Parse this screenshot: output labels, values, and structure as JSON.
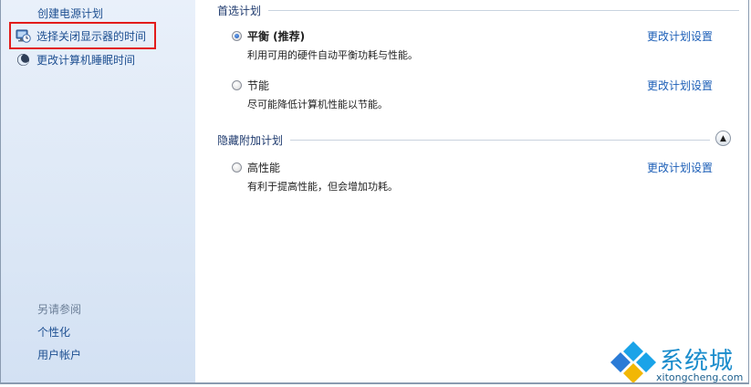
{
  "sidebar": {
    "items": [
      {
        "label": "创建电源计划",
        "icon": "none"
      },
      {
        "label": "选择关闭显示器的时间",
        "icon": "monitor-clock-icon"
      },
      {
        "label": "更改计算机睡眠时间",
        "icon": "moon-sleep-icon"
      }
    ],
    "see_also": "另请参阅",
    "see_also_links": [
      "个性化",
      "用户帐户"
    ]
  },
  "main": {
    "preferred_header": "首选计划",
    "hidden_header": "隐藏附加计划",
    "change_link": "更改计划设置",
    "plans": [
      {
        "name": "平衡 (推荐)",
        "desc": "利用可用的硬件自动平衡功耗与性能。",
        "selected": true
      },
      {
        "name": "节能",
        "desc": "尽可能降低计算机性能以节能。",
        "selected": false
      },
      {
        "name": "高性能",
        "desc": "有利于提高性能，但会增加功耗。",
        "selected": false
      }
    ],
    "collapse_glyph": "▲"
  },
  "watermark": {
    "brand": "系统城",
    "url": "xitongcheng.com"
  },
  "colors": {
    "link": "#1d5fb7",
    "sidebar_link": "#1d4f91",
    "highlight": "#e21b1b",
    "sidebar_bg": "#dde8f6"
  }
}
